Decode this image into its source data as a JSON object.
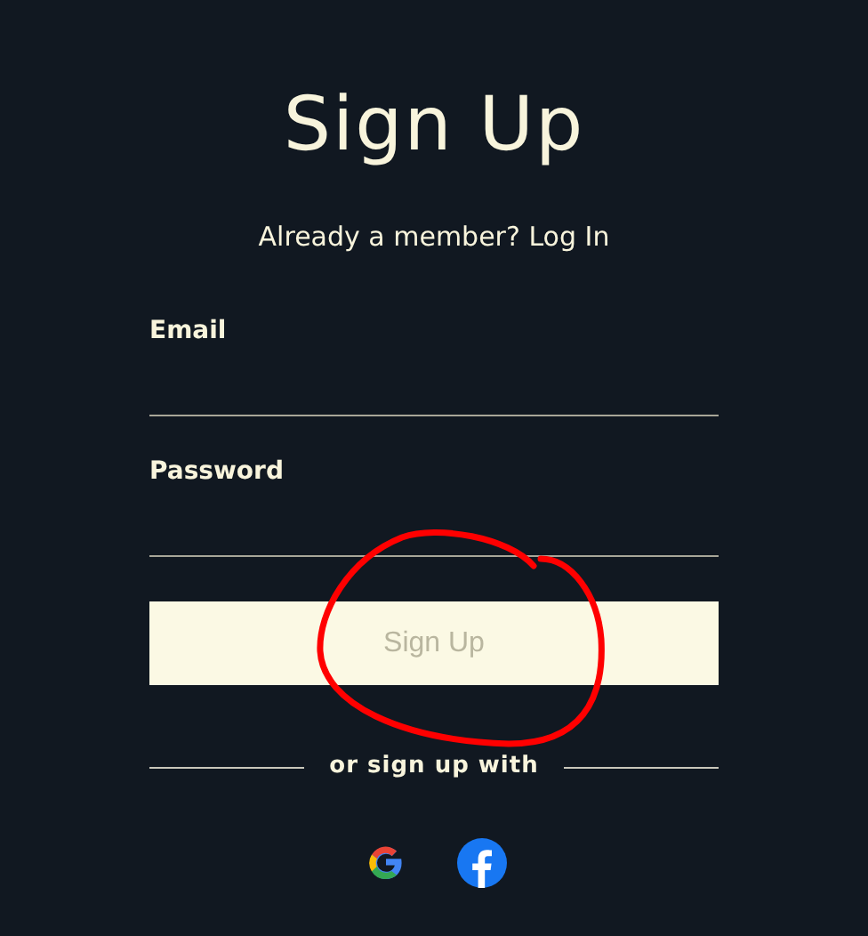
{
  "title": "Sign Up",
  "login_prompt": "Already a member? Log In",
  "fields": [
    {
      "label": "Email"
    },
    {
      "label": "Password"
    }
  ],
  "submit_button": "Sign Up",
  "divider_text": "or sign up with",
  "social_buttons": [
    {
      "kind": "google"
    },
    {
      "kind": "facebook"
    }
  ],
  "annotation": {
    "kind": "freehand-circle"
  }
}
